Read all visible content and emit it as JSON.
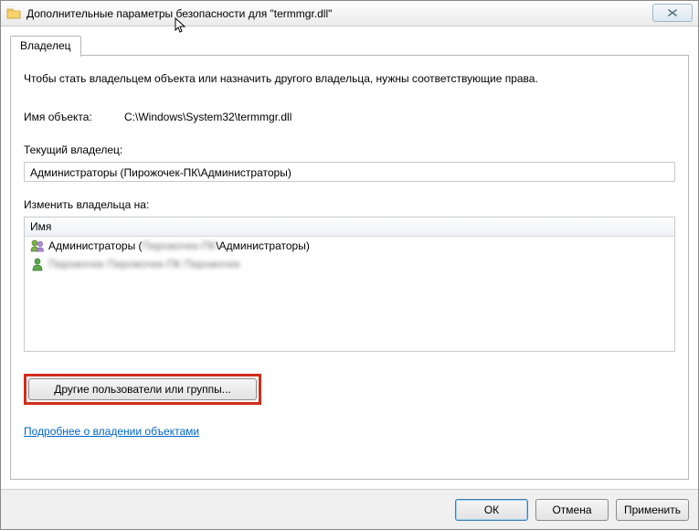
{
  "titlebar": {
    "title": "Дополнительные параметры безопасности  для \"termmgr.dll\"",
    "close": "✕"
  },
  "tab": {
    "label": "Владелец"
  },
  "content": {
    "description": "Чтобы стать владельцем объекта или назначить другого владельца, нужны соответствующие права.",
    "object_name_label": "Имя объекта:",
    "object_name_value": "C:\\Windows\\System32\\termmgr.dll",
    "current_owner_label": "Текущий владелец:",
    "current_owner_value": "Администраторы (Пирожочек-ПК\\Администраторы)",
    "change_owner_label": "Изменить владельца на:",
    "list_header": "Имя",
    "list_items": [
      {
        "text_pre": "Администраторы (",
        "text_blur": "Пирожочек-ПК",
        "text_post": "\\Администраторы)"
      },
      {
        "text_pre": "",
        "text_blur": "Пирожочек Пирожочек-ПК Пирожочек",
        "text_post": ""
      }
    ],
    "other_button": "Другие пользователи или группы...",
    "learn_more": "Подробнее о владении объектами"
  },
  "footer": {
    "ok": "ОК",
    "cancel": "Отмена",
    "apply": "Применить"
  }
}
